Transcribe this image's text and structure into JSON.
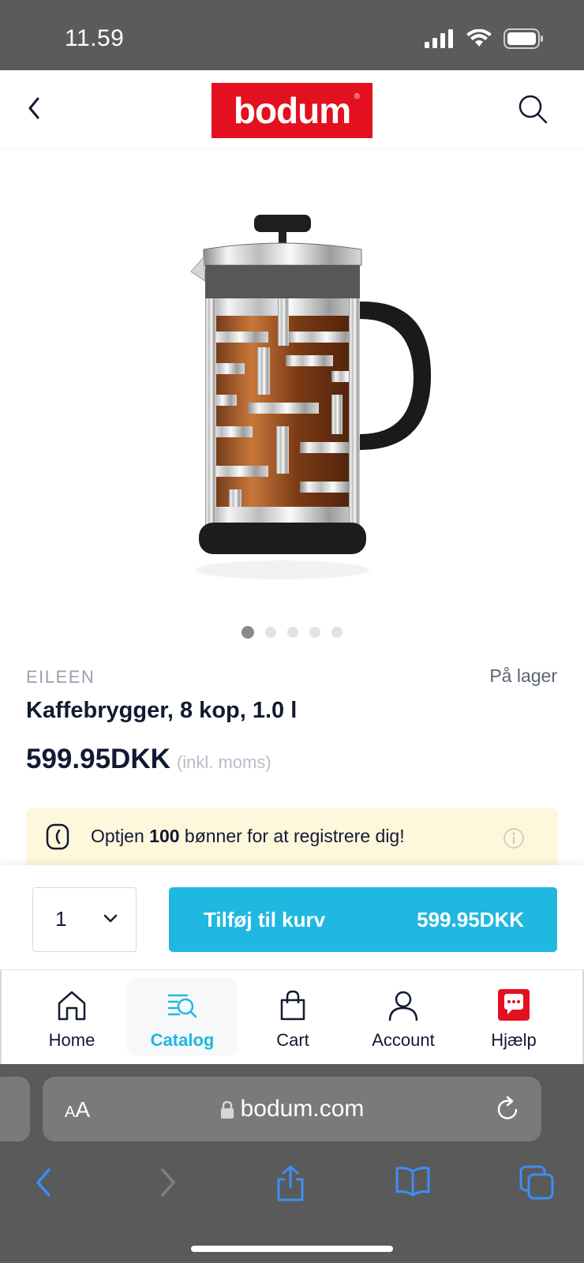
{
  "status": {
    "time": "11.59"
  },
  "header": {
    "logo_text": "bodum",
    "logo_mark": "®",
    "brand_color": "#e3101f"
  },
  "gallery": {
    "image_count": 5,
    "active_index": 0
  },
  "product": {
    "collection": "EILEEN",
    "stock_status": "På lager",
    "name": "Kaffebrygger, 8 kop, 1.0 l",
    "price": "599.95DKK",
    "vat_note": "(inkl. moms)"
  },
  "promo": {
    "text_before": "Optjen ",
    "points": "100",
    "text_after": " bønner for at registrere dig!"
  },
  "cart": {
    "quantity": "1",
    "add_label": "Tilføj til kurv",
    "add_price": "599.95DKK",
    "button_color": "#20b8e0"
  },
  "tabs": [
    {
      "label": "Home",
      "icon": "home-icon"
    },
    {
      "label": "Catalog",
      "icon": "catalog-search-icon",
      "active": true
    },
    {
      "label": "Cart",
      "icon": "shopping-bag-icon"
    },
    {
      "label": "Account",
      "icon": "user-icon"
    },
    {
      "label": "Hjælp",
      "icon": "chat-help-icon"
    }
  ],
  "safari": {
    "text_size_label_small": "A",
    "text_size_label_large": "A",
    "url": "bodum.com"
  }
}
